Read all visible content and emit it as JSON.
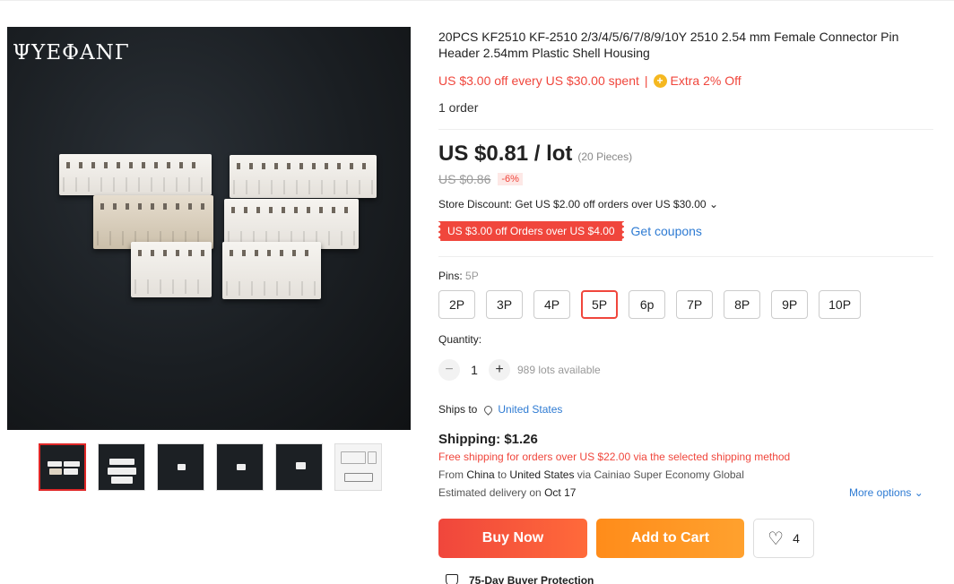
{
  "gallery": {
    "brand_watermark": "ΨΥΕΦΑΝΓ",
    "thumbnails": [
      "thumb-1",
      "thumb-2",
      "thumb-3",
      "thumb-4",
      "thumb-5",
      "thumb-6"
    ],
    "active_thumbnail": 0
  },
  "product": {
    "title": "20PCS KF2510 KF-2510 2/3/4/5/6/7/8/9/10Y 2510 2.54 mm Female Connector Pin Header 2.54mm Plastic Shell Housing",
    "promo_text": "US $3.00 off every US $30.00 spent",
    "promo_separator": "|",
    "extra_off": "Extra 2% Off",
    "orders": "1 order"
  },
  "pricing": {
    "price": "US $0.81 / lot",
    "pieces": "(20 Pieces)",
    "old_price": "US $0.86",
    "discount": "-6%",
    "store_discount": "Store Discount: Get US $2.00 off orders over US $30.00",
    "coupon": "US $3.00 off Orders over US $4.00",
    "get_coupons": "Get coupons"
  },
  "options": {
    "pins_label": "Pins:",
    "pins_selected": "5P",
    "pins": [
      "2P",
      "3P",
      "4P",
      "5P",
      "6p",
      "7P",
      "8P",
      "9P",
      "10P"
    ],
    "quantity_label": "Quantity:",
    "quantity": "1",
    "minus": "−",
    "plus": "+",
    "available": "989 lots available"
  },
  "shipping": {
    "ships_to_label": "Ships to",
    "country": "United States",
    "shipping_cost": "Shipping: $1.26",
    "free_shipping": "Free shipping for orders over US $22.00 via the selected shipping method",
    "from_prefix": "From",
    "from_country": "China",
    "to_word": "to",
    "to_country": "United States",
    "via": "via Cainiao Super Economy Global",
    "est_prefix": "Estimated delivery on",
    "est_date": "Oct 17",
    "more_options": "More options"
  },
  "actions": {
    "buy_now": "Buy Now",
    "add_to_cart": "Add to Cart",
    "wishlist_count": "4"
  },
  "protection": {
    "label": "75-Day Buyer Protection"
  },
  "colors": {
    "accent_red": "#f0463c",
    "orange": "#ff8c1a",
    "link_blue": "#2e7bd3"
  }
}
